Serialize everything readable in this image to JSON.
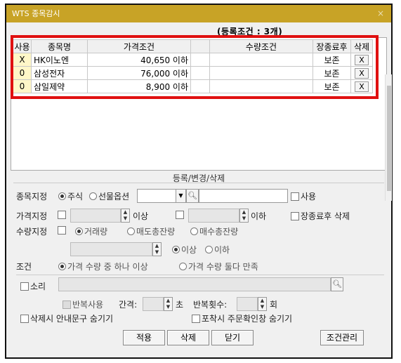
{
  "window": {
    "title": "WTS 종목감시",
    "close_icon": "×"
  },
  "condition_count": "(등록조건 : 3개)",
  "grid": {
    "headers": [
      "사용",
      "종목명",
      "가격조건",
      "",
      "수량조건",
      "장종료후",
      "삭제"
    ],
    "rows": [
      {
        "use": "X",
        "name": "HK이노엔",
        "price": "40,650 이하",
        "qty": "",
        "keep": "보존",
        "del": "X"
      },
      {
        "use": "0",
        "name": "삼성전자",
        "price": "76,000 이하",
        "qty": "",
        "keep": "보존",
        "del": "X"
      },
      {
        "use": "0",
        "name": "삼일제약",
        "price": "8,900 이하",
        "qty": "",
        "keep": "보존",
        "del": "X"
      }
    ]
  },
  "form": {
    "section_title": "등록/변경/삭제",
    "stock_label": "종목지정",
    "stock_radio_1": "주식",
    "stock_radio_2": "선물옵션",
    "use_label": "사용",
    "price_label": "가격지정",
    "above_label": "이상",
    "below_label": "이하",
    "keep_after_close": "장종료후 삭제",
    "qty_label": "수량지정",
    "qty_radio_1": "거래량",
    "qty_radio_2": "매도총잔량",
    "qty_radio_3": "매수총잔량",
    "qty_above": "이상",
    "qty_below": "이하",
    "cond_label": "조건",
    "cond_radio_1": "가격 수량 중 하나 이상",
    "cond_radio_2": "가격 수량 둘다 만족",
    "sound_label": "소리",
    "repeat_label": "반복사용",
    "interval_label": "간격:",
    "seconds_label": "초",
    "repeat_count_label": "반복횟수:",
    "times_label": "회",
    "hide_delete_msg": "삭제시 안내문구 숨기기",
    "hide_order_confirm": "포착시 주문확인창 숨기기"
  },
  "buttons": {
    "apply": "적용",
    "delete": "삭제",
    "close": "닫기",
    "manage": "조건관리"
  }
}
